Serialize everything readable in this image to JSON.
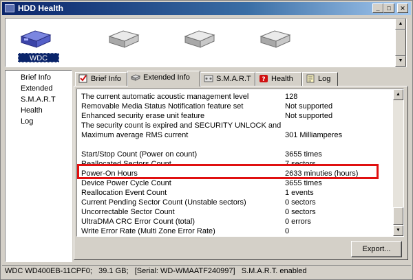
{
  "window": {
    "title": "HDD Health"
  },
  "drives": [
    {
      "label": "WDC",
      "selected": true
    },
    {
      "label": "",
      "selected": false
    },
    {
      "label": "",
      "selected": false
    },
    {
      "label": "",
      "selected": false
    }
  ],
  "nav": {
    "items": [
      {
        "label": "Brief Info"
      },
      {
        "label": "Extended"
      },
      {
        "label": "S.M.A.R.T"
      },
      {
        "label": "Health"
      },
      {
        "label": "Log"
      }
    ]
  },
  "tabs": [
    {
      "label": "Brief Info",
      "icon": "brief-info-icon"
    },
    {
      "label": "Extended Info",
      "icon": "extended-info-icon",
      "active": true
    },
    {
      "label": "S.M.A.R.T",
      "icon": "smart-icon"
    },
    {
      "label": "Health",
      "icon": "health-icon"
    },
    {
      "label": "Log",
      "icon": "log-icon"
    }
  ],
  "rows": [
    {
      "name": "The current automatic acoustic management level",
      "value": "128"
    },
    {
      "name": "Removable Media Status Notification feature set",
      "value": "Not supported"
    },
    {
      "name": "Enhanced security erase unit feature",
      "value": "Not supported"
    },
    {
      "name": "The security count is expired and SECURITY UNLOCK and...",
      "value": ""
    },
    {
      "name": "Maximum average RMS current",
      "value": "301 Milliamperes"
    },
    {
      "name": "",
      "value": ""
    },
    {
      "name": "Start/Stop Count (Power on count)",
      "value": "3655 times"
    },
    {
      "name": "Reallocated Sectors Count",
      "value": "7 sectors"
    },
    {
      "name": "Power-On Hours",
      "value": "2633 minuties (hours)"
    },
    {
      "name": "Device Power Cycle Count",
      "value": "3655 times"
    },
    {
      "name": "Reallocation Event Count",
      "value": "1 events"
    },
    {
      "name": "Current Pending Sector Count (Unstable sectors)",
      "value": "0 sectors"
    },
    {
      "name": "Uncorrectable Sector Count",
      "value": "0 sectors"
    },
    {
      "name": "UltraDMA CRC Error Count (total)",
      "value": "0 errors"
    },
    {
      "name": "Write Error Rate (Multi Zone Error Rate)",
      "value": "0"
    }
  ],
  "export_label": "Export...",
  "status": {
    "model": "WDC WD400EB-11CPF0;",
    "size": "39.1 GB;",
    "serial": "[Serial: WD-WMAATF240997]",
    "smart": "S.M.A.R.T. enabled"
  },
  "highlight_color": "#e01010",
  "accent": "#0a246a"
}
